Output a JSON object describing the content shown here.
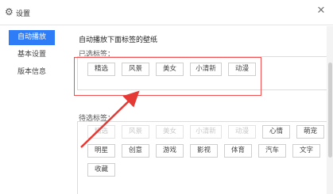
{
  "window": {
    "title": "设置",
    "icons": {
      "settings": "gear-icon",
      "close": "close-icon"
    }
  },
  "sidebar": {
    "items": [
      {
        "label": "自动播放",
        "active": true
      },
      {
        "label": "基本设置",
        "active": false
      },
      {
        "label": "版本信息",
        "active": false
      }
    ]
  },
  "main": {
    "heading": "自动播放下面标签的壁纸",
    "selected_label": "已选标签：",
    "selected_tags": [
      "精选",
      "风景",
      "美女",
      "小清新",
      "动漫"
    ],
    "available_label": "待选标签：",
    "available_tags_row1": [
      {
        "label": "精选",
        "disabled": true
      },
      {
        "label": "风景",
        "disabled": true
      },
      {
        "label": "美女",
        "disabled": true
      },
      {
        "label": "小清新",
        "disabled": true
      },
      {
        "label": "动漫",
        "disabled": true
      },
      {
        "label": "心情",
        "disabled": false
      },
      {
        "label": "萌宠",
        "disabled": false
      }
    ],
    "available_tags_row2": [
      "明星",
      "创意",
      "游戏",
      "影视",
      "体育",
      "汽车",
      "文字"
    ],
    "available_tags_row3": [
      "收藏"
    ]
  },
  "colors": {
    "accent": "#2e7cf6",
    "annotation": "#e53935"
  }
}
